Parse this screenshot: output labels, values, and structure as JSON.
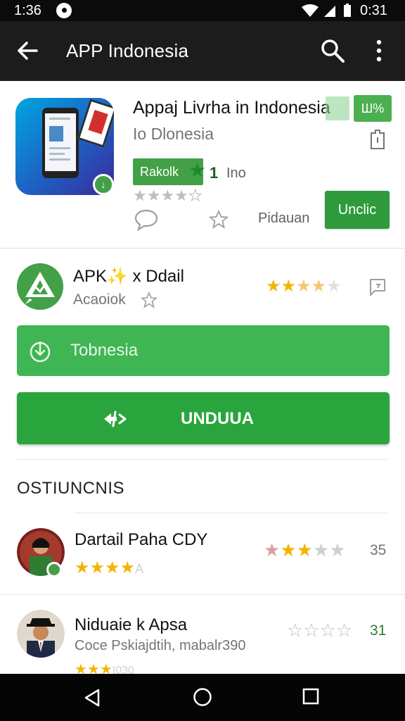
{
  "status_bar": {
    "time": "1:36",
    "clock_right": "0:31"
  },
  "app_bar": {
    "title": "APP Indonesia"
  },
  "app": {
    "name": "Appaj Livrha in Indonesia",
    "percent_badge": "Ш%",
    "subtitle": "Io Dlonesia",
    "rating_badge": "Rakolk",
    "rating_star": "★",
    "rating_value": "1",
    "rating_count": "Ino",
    "stars_filled": 4,
    "stars_total": 5,
    "developer_label": "Pidauan",
    "install_label": "Unclic"
  },
  "apk_row": {
    "name": "APK✨ x Ddail",
    "subtitle": "Acaoiok",
    "rating": 3.5
  },
  "buttons": {
    "primary_light_label": "Tobnesia",
    "primary_dark_label": "UNDUUA"
  },
  "section_title": "OSTIUNCNIS",
  "reviews": [
    {
      "name": "Dartail Paha CDY",
      "stars_text": "★★★★",
      "stars_suffix": "A",
      "rating_right": 3,
      "score": "35",
      "score_color": "#757575"
    },
    {
      "name": "Niduaie k Apsa",
      "text": "Coce Pskiajdtih, mabalr390",
      "stars_text": "★★★",
      "stars_suffix": "I030",
      "rating_right": 0,
      "score": "31",
      "score_color": "#2e7d32"
    }
  ],
  "colors": {
    "accent_green": "#2aa53e",
    "light_green": "#3fb653",
    "star_yellow": "#f5b301",
    "app_bar": "#1c1c1c"
  }
}
